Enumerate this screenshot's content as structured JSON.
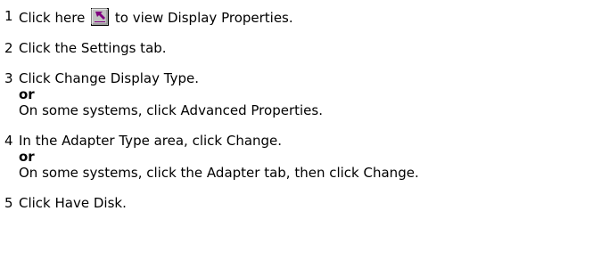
{
  "steps": [
    {
      "number": "1",
      "before_icon": "Click here",
      "after_icon": "to view Display Properties.",
      "icon": "shortcut-arrow-icon"
    },
    {
      "number": "2",
      "text": "Click the Settings tab."
    },
    {
      "number": "3",
      "text": "Click Change Display Type.",
      "or_label": "or",
      "alt_text": "On some systems, click Advanced Properties."
    },
    {
      "number": "4",
      "text": "In the Adapter Type area, click Change.",
      "or_label": "or",
      "alt_text": "On some systems, click the Adapter tab, then click Change."
    },
    {
      "number": "5",
      "text": "Click Have Disk."
    }
  ],
  "colors": {
    "icon_face": "#c0c0c0",
    "icon_arrow": "#800080"
  }
}
